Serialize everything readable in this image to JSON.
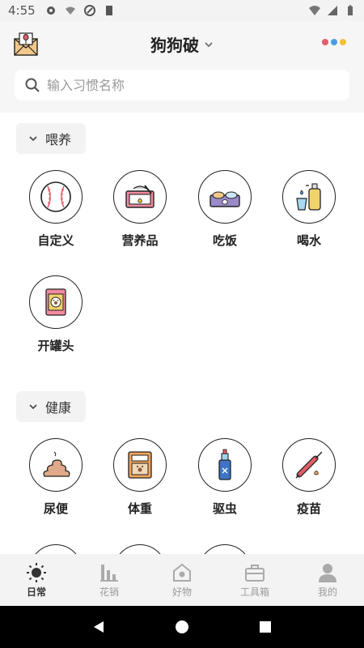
{
  "status_bar": {
    "time": "4:55"
  },
  "header": {
    "title": "狗狗破",
    "search_placeholder": "输入习惯名称",
    "menu_dot_colors": [
      "#e35d6a",
      "#4a9fe0",
      "#f1c232"
    ]
  },
  "sections": [
    {
      "label": "喂养",
      "items": [
        {
          "label": "自定义",
          "icon": "baseball-icon"
        },
        {
          "label": "营养品",
          "icon": "nutrition-can-icon"
        },
        {
          "label": "吃饭",
          "icon": "food-bowl-icon"
        },
        {
          "label": "喝水",
          "icon": "water-bottle-icon"
        },
        {
          "label": "开罐头",
          "icon": "canned-food-icon"
        }
      ]
    },
    {
      "label": "健康",
      "items": [
        {
          "label": "尿便",
          "icon": "poop-icon"
        },
        {
          "label": "体重",
          "icon": "weight-scale-icon"
        },
        {
          "label": "驱虫",
          "icon": "deworm-spray-icon"
        },
        {
          "label": "疫苗",
          "icon": "vaccine-syringe-icon"
        }
      ]
    }
  ],
  "bottom_nav": [
    {
      "label": "日常",
      "icon": "sun-icon",
      "active": true
    },
    {
      "label": "花销",
      "icon": "bar-chart-icon",
      "active": false
    },
    {
      "label": "好物",
      "icon": "pet-house-icon",
      "active": false
    },
    {
      "label": "工具箱",
      "icon": "toolbox-icon",
      "active": false
    },
    {
      "label": "我的",
      "icon": "user-icon",
      "active": false
    }
  ],
  "colors": {
    "header_bg": "#f6f6f6",
    "accent_pink": "#e35d6a",
    "nav_inactive": "#9b9b9b"
  }
}
